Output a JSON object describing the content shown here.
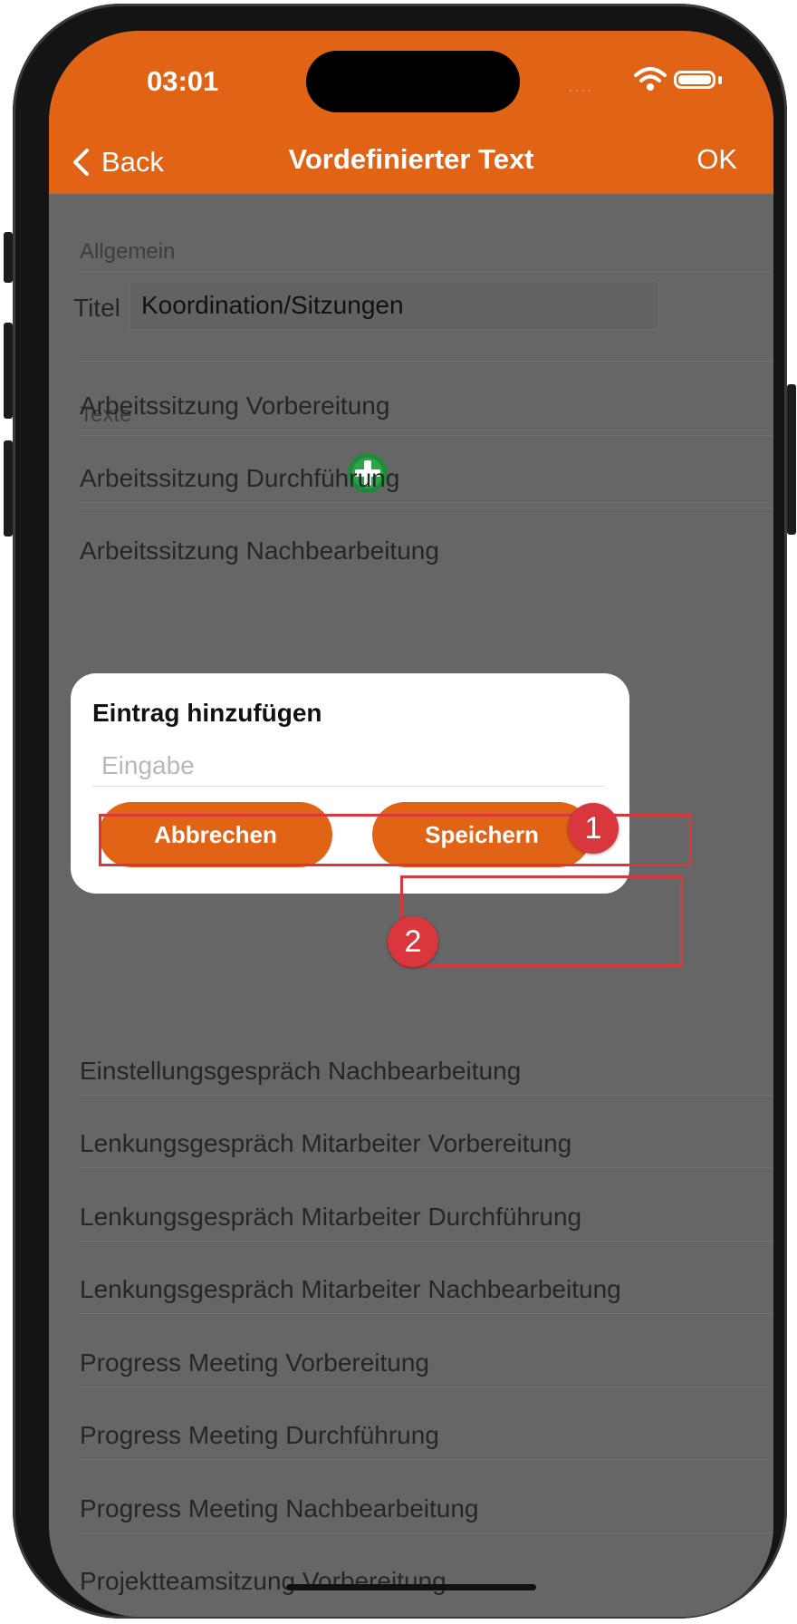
{
  "status_bar": {
    "time": "03:01",
    "cellular_dots": "....",
    "wifi_icon": "wifi-icon",
    "battery_icon": "battery-icon"
  },
  "navbar": {
    "back_label": "Back",
    "title": "Vordefinierter Text",
    "ok_label": "OK",
    "color": "#e06316"
  },
  "sections": {
    "general": {
      "header": "Allgemein",
      "title_label": "Titel",
      "title_value": "Koordination/Sitzungen"
    },
    "texts": {
      "header": "Texte",
      "add_icon": "add-circle-icon",
      "items": [
        "Arbeitssitzung Vorbereitung",
        "Arbeitssitzung Durchführung",
        "Arbeitssitzung Nachbearbeitung",
        "Einstellungsgespräch Nachbearbeitung",
        "Lenkungsgespräch Mitarbeiter Vorbereitung",
        "Lenkungsgespräch Mitarbeiter Durchführung",
        "Lenkungsgespräch Mitarbeiter Nachbearbeitung",
        "Progress Meeting Vorbereitung",
        "Progress Meeting Durchführung",
        "Progress Meeting Nachbearbeitung",
        "Projektteamsitzung Vorbereitung"
      ]
    }
  },
  "dialog": {
    "title": "Eintrag hinzufügen",
    "input_placeholder": "Eingabe",
    "input_value": "",
    "cancel_label": "Abbrechen",
    "save_label": "Speichern"
  },
  "annotations": {
    "marker_1": "1",
    "marker_2": "2",
    "highlight_color": "#d9363e"
  }
}
